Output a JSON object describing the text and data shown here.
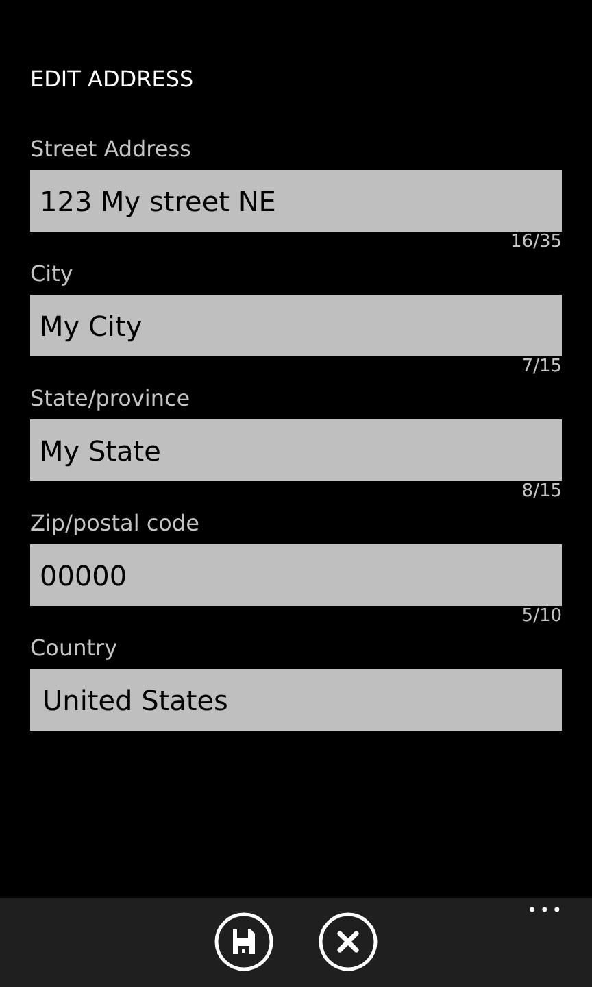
{
  "page": {
    "title": "EDIT ADDRESS"
  },
  "fields": [
    {
      "kind": "text",
      "label": "Street Address",
      "value": "123 My street NE",
      "counter": "16/35"
    },
    {
      "kind": "text",
      "label": "City",
      "value": "My City",
      "counter": "7/15"
    },
    {
      "kind": "text",
      "label": "State/province",
      "value": "My State",
      "counter": "8/15"
    },
    {
      "kind": "text",
      "label": "Zip/postal code",
      "value": "00000",
      "counter": "5/10"
    },
    {
      "kind": "picker",
      "label": "Country",
      "value": "United States"
    }
  ],
  "app_bar": {
    "buttons": [
      {
        "kind": "save"
      },
      {
        "kind": "cancel"
      }
    ],
    "more": "•••"
  }
}
